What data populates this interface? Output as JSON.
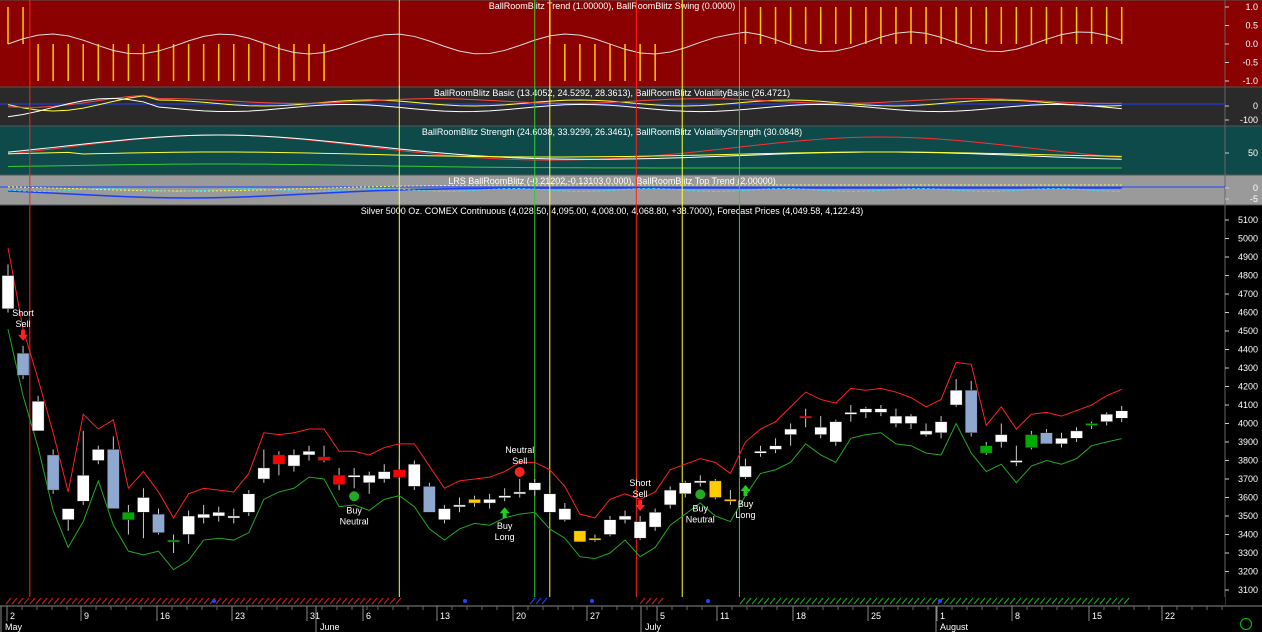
{
  "colors": {
    "panel1_bg": "#8b0000",
    "panel2_bg": "#2a2a2a",
    "panel3_bg": "#0e4a4a",
    "panel4_bg": "#9a9a9a",
    "main_bg": "#000000",
    "up_candle": "#ffffff",
    "down_candle": "#8fa8d0",
    "strong_up": "#00aa00",
    "strong_down": "#ff0000",
    "neutral_candle": "#ffcc00",
    "upper_band": "#ff2020",
    "lower_band": "#22aa22"
  },
  "chart_data": [
    {
      "type": "line",
      "title": "BallRoomBlitz Trend (1.00000), BallRoomBlitz Swing (0.0000)",
      "ylim": [
        -1.2,
        1.2
      ],
      "yticks": [
        "1.0",
        "0.5",
        "0.0",
        "-0.5",
        "-1.0"
      ]
    },
    {
      "type": "line",
      "title": "BallRoomBlitz Basic (13.4052, 24.5292, 28.3613), BallRoomBlitz VolatilityBasic (26.4721)",
      "ylim": [
        -180,
        120
      ],
      "yticks": [
        "0",
        "-100"
      ]
    },
    {
      "type": "line",
      "title": "BallRoomBlitz Strength (24.6038, 33.9299, 26.3461), BallRoomBlitz VolatilityStrength (30.0848)",
      "ylim": [
        0,
        100
      ],
      "yticks": [
        "50"
      ]
    },
    {
      "type": "line",
      "title": "LRS BallRoomBlitz (-0.21202,-0.13103,0.000), BallRoomBlitz Top Trend (2.00000)",
      "ylim": [
        -5,
        5
      ],
      "yticks": [
        "0",
        "-5"
      ]
    },
    {
      "type": "candlestick",
      "title": "Silver 5000 Oz. COMEX Continuous (4,028.50, 4,095.00, 4,008.00, 4,068.80, +38.7000), Forecast Prices (4,049.58, 4,122.43)",
      "ylim": [
        3050,
        5200
      ],
      "yticks": [
        "5100",
        "5000",
        "4900",
        "4800",
        "4700",
        "4600",
        "4500",
        "4400",
        "4300",
        "4200",
        "4100",
        "4000",
        "3900",
        "3800",
        "3700",
        "3600",
        "3500",
        "3400",
        "3300",
        "3200",
        "3100"
      ],
      "xticks": [
        "2",
        "9",
        "16",
        "23",
        "31",
        "6",
        "13",
        "20",
        "27",
        "5",
        "11",
        "18",
        "25",
        "1",
        "8",
        "15",
        "22"
      ],
      "months": [
        "May",
        "June",
        "July",
        "August"
      ],
      "candles": [
        {
          "o": 4800,
          "h": 4860,
          "l": 4600,
          "c": 4620,
          "t": "up"
        },
        {
          "o": 4380,
          "h": 4420,
          "l": 4240,
          "c": 4260,
          "t": "down"
        },
        {
          "o": 4120,
          "h": 4150,
          "l": 3960,
          "c": 3960,
          "t": "up"
        },
        {
          "o": 3830,
          "h": 3860,
          "l": 3620,
          "c": 3640,
          "t": "down"
        },
        {
          "o": 3480,
          "h": 3540,
          "l": 3420,
          "c": 3540,
          "t": "up"
        },
        {
          "o": 3580,
          "h": 3960,
          "l": 3560,
          "c": 3720,
          "t": "up"
        },
        {
          "o": 3800,
          "h": 3880,
          "l": 3780,
          "c": 3860,
          "t": "up"
        },
        {
          "o": 3860,
          "h": 3930,
          "l": 3540,
          "c": 3540,
          "t": "down"
        },
        {
          "o": 3520,
          "h": 3560,
          "l": 3400,
          "c": 3480,
          "t": "strong_up"
        },
        {
          "o": 3600,
          "h": 3650,
          "l": 3380,
          "c": 3520,
          "t": "up"
        },
        {
          "o": 3510,
          "h": 3540,
          "l": 3400,
          "c": 3410,
          "t": "down"
        },
        {
          "o": 3360,
          "h": 3400,
          "l": 3300,
          "c": 3370,
          "t": "strong_up"
        },
        {
          "o": 3400,
          "h": 3530,
          "l": 3350,
          "c": 3500,
          "t": "up"
        },
        {
          "o": 3490,
          "h": 3560,
          "l": 3460,
          "c": 3510,
          "t": "up"
        },
        {
          "o": 3500,
          "h": 3550,
          "l": 3470,
          "c": 3520,
          "t": "up"
        },
        {
          "o": 3490,
          "h": 3540,
          "l": 3460,
          "c": 3500,
          "t": "up"
        },
        {
          "o": 3520,
          "h": 3640,
          "l": 3500,
          "c": 3620,
          "t": "up"
        },
        {
          "o": 3700,
          "h": 3860,
          "l": 3680,
          "c": 3760,
          "t": "up"
        },
        {
          "o": 3780,
          "h": 3850,
          "l": 3720,
          "c": 3830,
          "t": "strong_down"
        },
        {
          "o": 3770,
          "h": 3860,
          "l": 3740,
          "c": 3830,
          "t": "up"
        },
        {
          "o": 3830,
          "h": 3880,
          "l": 3800,
          "c": 3850,
          "t": "up"
        },
        {
          "o": 3820,
          "h": 3880,
          "l": 3790,
          "c": 3800,
          "t": "strong_down"
        },
        {
          "o": 3720,
          "h": 3760,
          "l": 3640,
          "c": 3670,
          "t": "strong_down"
        },
        {
          "o": 3720,
          "h": 3760,
          "l": 3650,
          "c": 3710,
          "t": "up"
        },
        {
          "o": 3680,
          "h": 3740,
          "l": 3620,
          "c": 3720,
          "t": "up"
        },
        {
          "o": 3700,
          "h": 3780,
          "l": 3680,
          "c": 3740,
          "t": "up"
        },
        {
          "o": 3750,
          "h": 3800,
          "l": 3700,
          "c": 3710,
          "t": "strong_down"
        },
        {
          "o": 3780,
          "h": 3800,
          "l": 3640,
          "c": 3660,
          "t": "up"
        },
        {
          "o": 3660,
          "h": 3680,
          "l": 3520,
          "c": 3520,
          "t": "down"
        },
        {
          "o": 3480,
          "h": 3560,
          "l": 3460,
          "c": 3540,
          "t": "up"
        },
        {
          "o": 3560,
          "h": 3600,
          "l": 3520,
          "c": 3550,
          "t": "up"
        },
        {
          "o": 3570,
          "h": 3610,
          "l": 3550,
          "c": 3590,
          "t": "neutral"
        },
        {
          "o": 3570,
          "h": 3620,
          "l": 3540,
          "c": 3590,
          "t": "up"
        },
        {
          "o": 3600,
          "h": 3650,
          "l": 3580,
          "c": 3610,
          "t": "up"
        },
        {
          "o": 3620,
          "h": 3700,
          "l": 3600,
          "c": 3630,
          "t": "up"
        },
        {
          "o": 3640,
          "h": 3700,
          "l": 3610,
          "c": 3680,
          "t": "up"
        },
        {
          "o": 3620,
          "h": 3660,
          "l": 3520,
          "c": 3520,
          "t": "up"
        },
        {
          "o": 3540,
          "h": 3570,
          "l": 3470,
          "c": 3480,
          "t": "up"
        },
        {
          "o": 3420,
          "h": 3420,
          "l": 3370,
          "c": 3360,
          "t": "neutral"
        },
        {
          "o": 3370,
          "h": 3400,
          "l": 3360,
          "c": 3380,
          "t": "neutral"
        },
        {
          "o": 3400,
          "h": 3500,
          "l": 3390,
          "c": 3480,
          "t": "up"
        },
        {
          "o": 3480,
          "h": 3530,
          "l": 3460,
          "c": 3500,
          "t": "up"
        },
        {
          "o": 3470,
          "h": 3500,
          "l": 3370,
          "c": 3380,
          "t": "up"
        },
        {
          "o": 3440,
          "h": 3540,
          "l": 3420,
          "c": 3520,
          "t": "up"
        },
        {
          "o": 3560,
          "h": 3660,
          "l": 3540,
          "c": 3640,
          "t": "up"
        },
        {
          "o": 3620,
          "h": 3690,
          "l": 3600,
          "c": 3680,
          "t": "up"
        },
        {
          "o": 3680,
          "h": 3720,
          "l": 3660,
          "c": 3690,
          "t": "up"
        },
        {
          "o": 3690,
          "h": 3700,
          "l": 3590,
          "c": 3600,
          "t": "neutral"
        },
        {
          "o": 3580,
          "h": 3640,
          "l": 3560,
          "c": 3590,
          "t": "neutral"
        },
        {
          "o": 3770,
          "h": 3810,
          "l": 3700,
          "c": 3710,
          "t": "up"
        },
        {
          "o": 3850,
          "h": 3880,
          "l": 3820,
          "c": 3840,
          "t": "up"
        },
        {
          "o": 3860,
          "h": 3920,
          "l": 3840,
          "c": 3880,
          "t": "up"
        },
        {
          "o": 3940,
          "h": 4000,
          "l": 3880,
          "c": 3970,
          "t": "up"
        },
        {
          "o": 4040,
          "h": 4080,
          "l": 3980,
          "c": 4040,
          "t": "strong_down"
        },
        {
          "o": 3980,
          "h": 4040,
          "l": 3920,
          "c": 3940,
          "t": "up"
        },
        {
          "o": 3900,
          "h": 4020,
          "l": 3880,
          "c": 4010,
          "t": "up"
        },
        {
          "o": 4050,
          "h": 4100,
          "l": 4010,
          "c": 4060,
          "t": "up"
        },
        {
          "o": 4060,
          "h": 4090,
          "l": 4030,
          "c": 4080,
          "t": "up"
        },
        {
          "o": 4080,
          "h": 4100,
          "l": 4040,
          "c": 4060,
          "t": "up"
        },
        {
          "o": 4040,
          "h": 4080,
          "l": 3980,
          "c": 4000,
          "t": "up"
        },
        {
          "o": 4000,
          "h": 4050,
          "l": 3970,
          "c": 4040,
          "t": "up"
        },
        {
          "o": 3960,
          "h": 4000,
          "l": 3930,
          "c": 3940,
          "t": "up"
        },
        {
          "o": 3950,
          "h": 4040,
          "l": 3920,
          "c": 4010,
          "t": "up"
        },
        {
          "o": 4100,
          "h": 4240,
          "l": 4090,
          "c": 4180,
          "t": "up"
        },
        {
          "o": 4180,
          "h": 4230,
          "l": 3930,
          "c": 3950,
          "t": "down"
        },
        {
          "o": 3880,
          "h": 3900,
          "l": 3830,
          "c": 3840,
          "t": "strong_up"
        },
        {
          "o": 3900,
          "h": 4000,
          "l": 3870,
          "c": 3940,
          "t": "up"
        },
        {
          "o": 3790,
          "h": 3880,
          "l": 3770,
          "c": 3800,
          "t": "up"
        },
        {
          "o": 3940,
          "h": 3960,
          "l": 3860,
          "c": 3870,
          "t": "strong_up"
        },
        {
          "o": 3950,
          "h": 3970,
          "l": 3890,
          "c": 3890,
          "t": "down"
        },
        {
          "o": 3890,
          "h": 3950,
          "l": 3870,
          "c": 3920,
          "t": "up"
        },
        {
          "o": 3920,
          "h": 3980,
          "l": 3900,
          "c": 3960,
          "t": "up"
        },
        {
          "o": 3990,
          "h": 4010,
          "l": 3970,
          "c": 4000,
          "t": "strong_up"
        },
        {
          "o": 4010,
          "h": 4060,
          "l": 3990,
          "c": 4050,
          "t": "up"
        },
        {
          "o": 4028.5,
          "h": 4095,
          "l": 4008,
          "c": 4068.8,
          "t": "up"
        }
      ],
      "signals": [
        {
          "bar": 1,
          "label": "Short Sell",
          "kind": "down"
        },
        {
          "bar": 23,
          "label": "Buy Neutral",
          "kind": "neutral_up"
        },
        {
          "bar": 33,
          "label": "Buy Long",
          "kind": "up"
        },
        {
          "bar": 34,
          "label": "Neutral Sell",
          "kind": "neutral_down"
        },
        {
          "bar": 42,
          "label": "Short Sell",
          "kind": "down"
        },
        {
          "bar": 46,
          "label": "Buy Neutral",
          "kind": "neutral_up"
        },
        {
          "bar": 49,
          "label": "Buy Long",
          "kind": "up"
        }
      ]
    }
  ]
}
